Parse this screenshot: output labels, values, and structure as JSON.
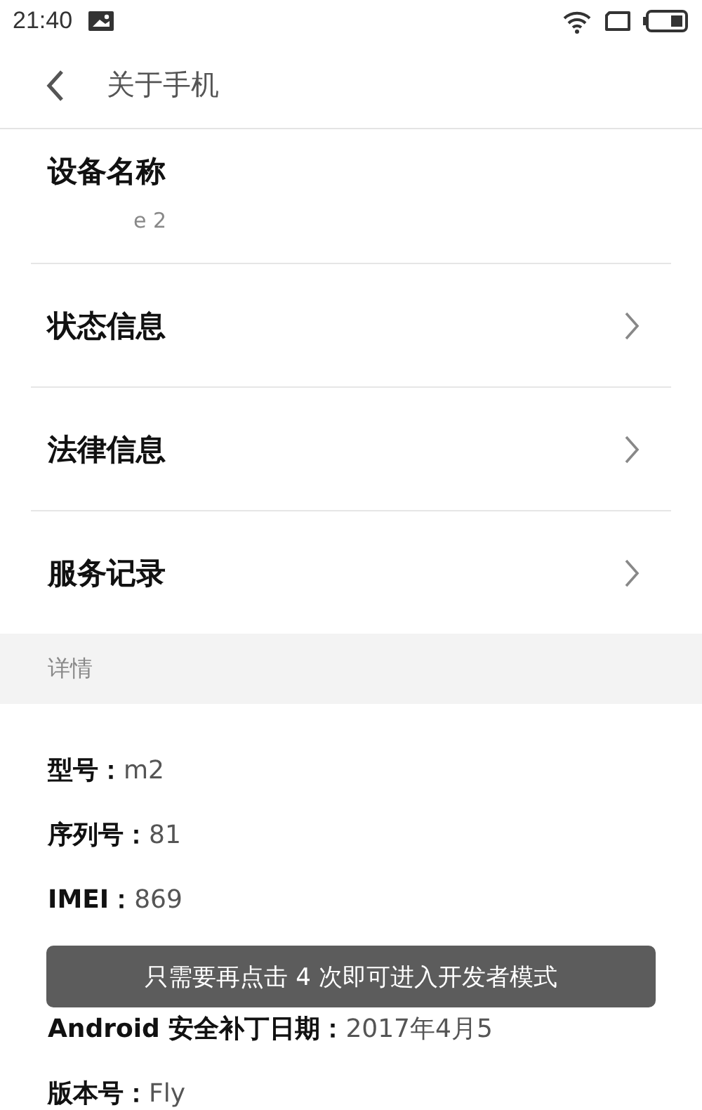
{
  "status_bar": {
    "time": "21:40"
  },
  "header": {
    "title": "关于手机"
  },
  "device_name": {
    "label": "设备名称",
    "value": "e 2"
  },
  "menu_items": [
    {
      "label": "状态信息"
    },
    {
      "label": "法律信息"
    },
    {
      "label": "服务记录"
    }
  ],
  "section": {
    "title": "详情"
  },
  "details": [
    {
      "label": "型号：",
      "value": "m2"
    },
    {
      "label": "序列号：",
      "value": "81"
    },
    {
      "label": "IMEI：",
      "value": "869"
    },
    {
      "label": "Android 安全补丁日期：",
      "value": "2017年4月5"
    },
    {
      "label": "版本号：",
      "value": "Fly"
    }
  ],
  "toast": {
    "message": "只需要再点击 4 次即可进入开发者模式"
  }
}
